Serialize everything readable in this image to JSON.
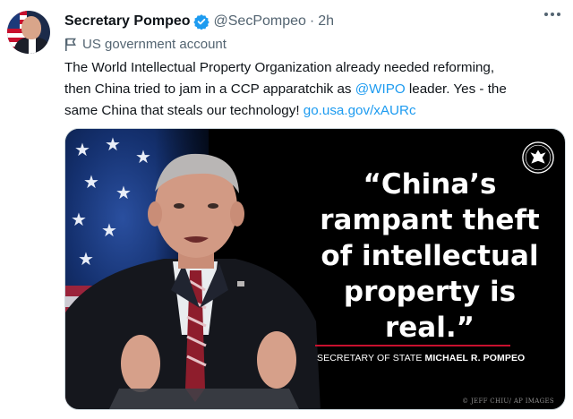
{
  "account": {
    "display_name": "Secretary Pompeo",
    "verified_icon": "verified-badge-icon",
    "handle": "@SecPompeo",
    "separator": "·",
    "time": "2h",
    "label_icon": "flag-icon",
    "label": "US government account"
  },
  "tweet": {
    "line1": "The World Intellectual Property Organization already needed reforming,",
    "line2_pre": "then China tried to jam in a CCP apparatchik as ",
    "line2_mention": "@WIPO",
    "line2_post": " leader. Yes - the",
    "line3_pre": "same China that steals our technology! ",
    "line3_link": "go.usa.gov/xAURc"
  },
  "media": {
    "quote_lines": [
      "“China’s",
      "rampant theft",
      "of intellectual",
      "property is",
      "real.”"
    ],
    "attribution_title": "SECRETARY OF STATE ",
    "attribution_name": "MICHAEL R. POMPEO",
    "photo_credit": "© JEFF CHIU/ AP IMAGES",
    "seal_icon": "state-department-seal-icon"
  },
  "colors": {
    "link": "#1d9bf0",
    "verified": "#1d9bf0",
    "secondary_text": "#536471",
    "accent_rule": "#c8102e"
  }
}
